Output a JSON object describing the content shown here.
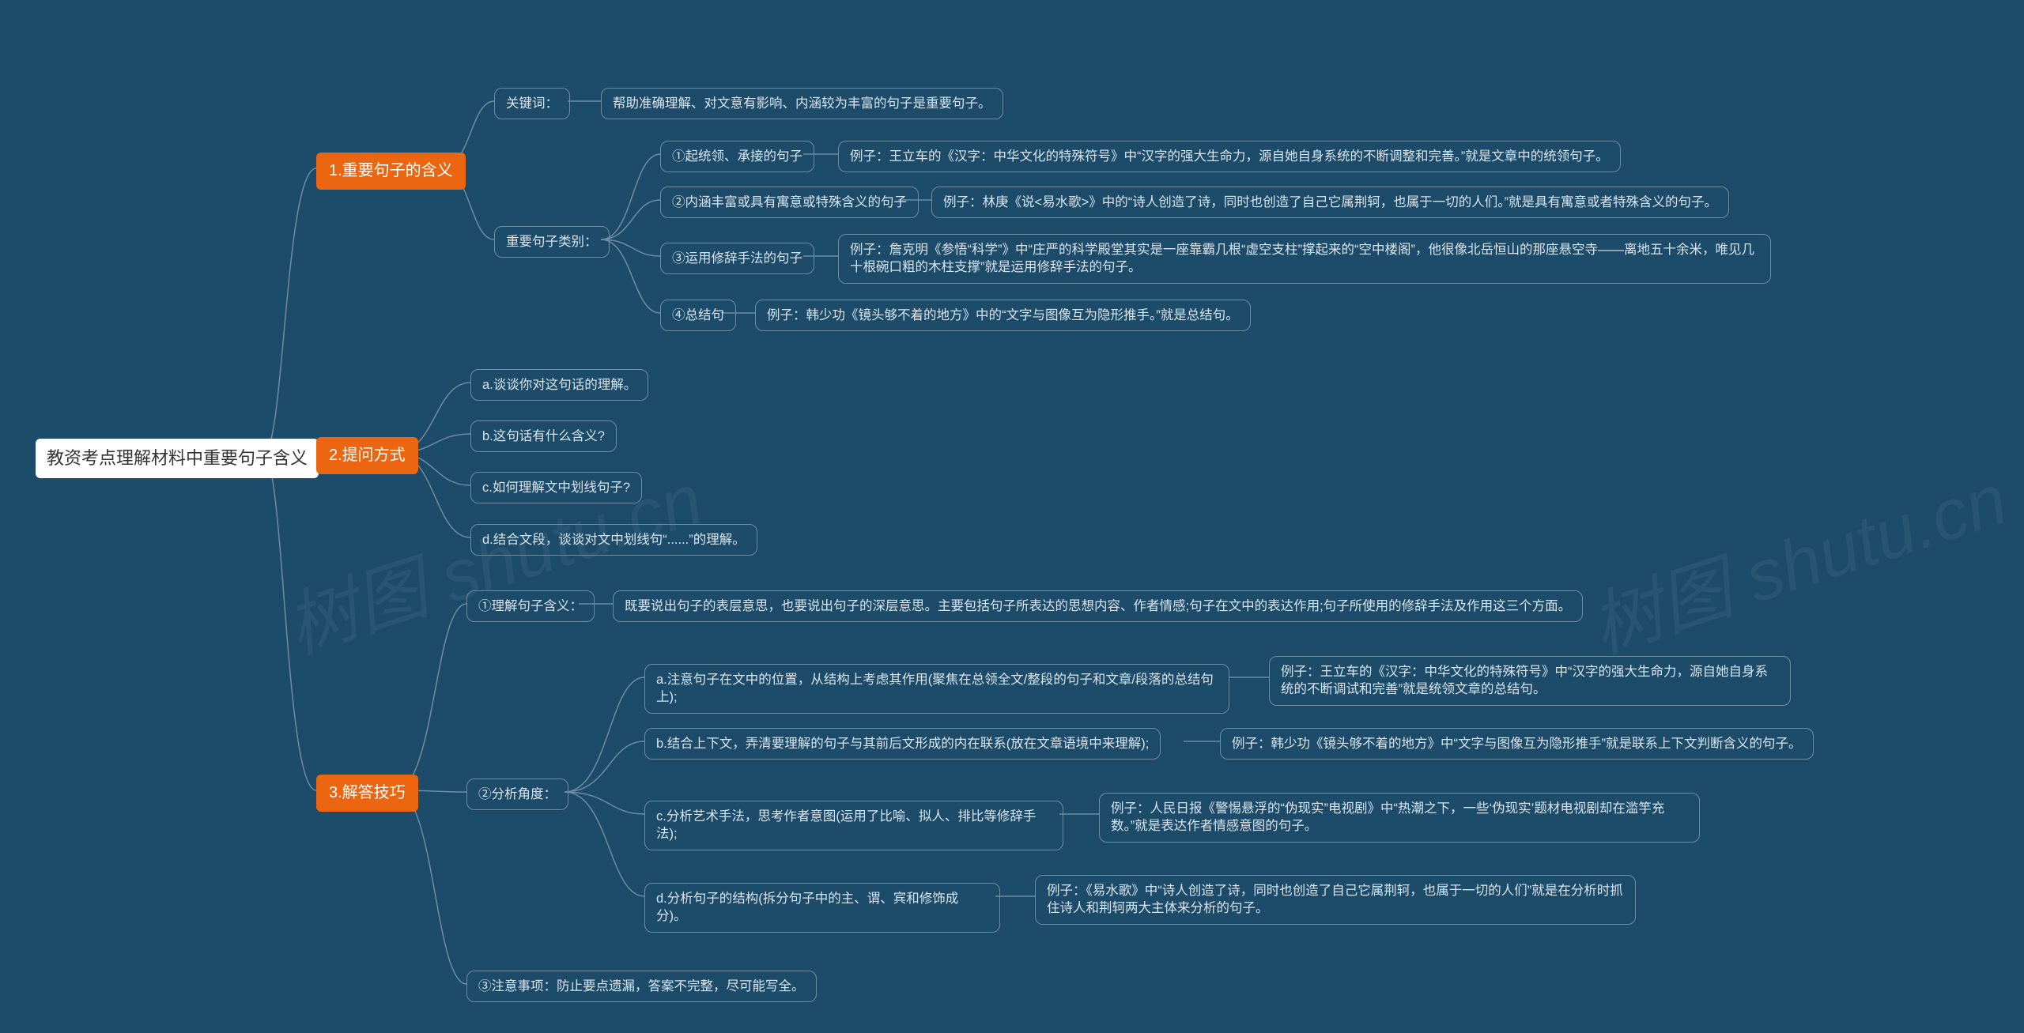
{
  "watermark": "树图 shutu.cn",
  "root": {
    "label": "教资考点理解材料中重要句子含义"
  },
  "b1": {
    "label": "1.重要句子的含义",
    "c1": {
      "label": "关键词：",
      "leaf": "帮助准确理解、对文意有影响、内涵较为丰富的句子是重要句子。"
    },
    "c2": {
      "label": "重要句子类别：",
      "t1": {
        "label": "①起统领、承接的句子",
        "ex": "例子：王立车的《汉字：中华文化的特殊符号》中“汉字的强大生命力，源自她自身系统的不断调整和完善。”就是文章中的统领句子。"
      },
      "t2": {
        "label": "②内涵丰富或具有寓意或特殊含义的句子",
        "ex": "例子：林庚《说<易水歌>》中的“诗人创造了诗，同时也创造了自己它属荆轲，也属于一切的人们。”就是具有寓意或者特殊含义的句子。"
      },
      "t3": {
        "label": "③运用修辞手法的句子",
        "ex": "例子：詹克明《参悟“科学”》中“庄严的科学殿堂其实是一座靠霸几根“虚空支柱”撑起来的“空中楼阁”，他很像北岳恒山的那座悬空寺——离地五十余米，唯见几十根碗口粗的木柱支撑”就是运用修辞手法的句子。"
      },
      "t4": {
        "label": "④总结句",
        "ex": "例子：韩少功《镜头够不着的地方》中的“文字与图像互为隐形推手。”就是总结句。"
      }
    }
  },
  "b2": {
    "label": "2.提问方式",
    "a": "a.谈谈你对这句话的理解。",
    "b": "b.这句话有什么含义?",
    "c": "c.如何理解文中划线句子?",
    "d": "d.结合文段，谈谈对文中划线句“......”的理解。"
  },
  "b3": {
    "label": "3.解答技巧",
    "c1": {
      "label": "①理解句子含义：",
      "leaf": "既要说出句子的表层意思，也要说出句子的深层意思。主要包括句子所表达的思想内容、作者情感;句子在文中的表达作用;句子所使用的修辞手法及作用这三个方面。"
    },
    "c2": {
      "label": "②分析角度：",
      "a": {
        "label": "a.注意句子在文中的位置，从结构上考虑其作用(聚焦在总领全文/整段的句子和文章/段落的总结句上);",
        "ex": "例子：王立车的《汉字：中华文化的特殊符号》中“汉字的强大生命力，源自她自身系统的不断调试和完善”就是统领文章的总结句。"
      },
      "b": {
        "label": "b.结合上下文，弄清要理解的句子与其前后文形成的内在联系(放在文章语境中来理解);",
        "ex": "例子：韩少功《镜头够不着的地方》中“文字与图像互为隐形推手”就是联系上下文判断含义的句子。"
      },
      "c": {
        "label": "c.分析艺术手法，思考作者意图(运用了比喻、拟人、排比等修辞手法);",
        "ex": "例子：人民日报《警惕悬浮的“伪现实”电视剧》中“热潮之下，一些‘伪现实’题材电视剧却在滥竽充数。”就是表达作者情感意图的句子。"
      },
      "d": {
        "label": "d.分析句子的结构(拆分句子中的主、谓、宾和修饰成分)。",
        "ex": "例子：《易水歌》中“诗人创造了诗，同时也创造了自己它属荆轲，也属于一切的人们”就是在分析时抓住诗人和荆轲两大主体来分析的句子。"
      }
    },
    "c3": {
      "label": "③注意事项：防止要点遗漏，答案不完整，尽可能写全。"
    }
  }
}
